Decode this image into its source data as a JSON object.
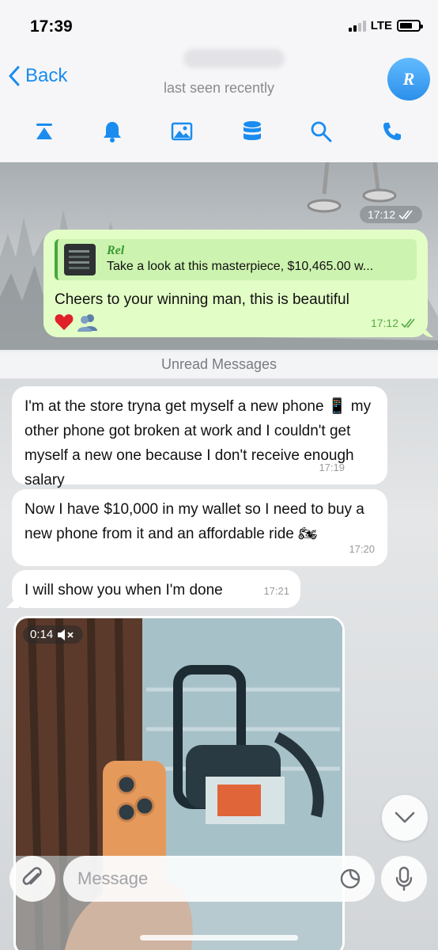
{
  "status_bar": {
    "time": "17:39",
    "network": "LTE",
    "battery_percent": 70
  },
  "header": {
    "back_label": "Back",
    "subtitle": "last seen recently",
    "avatar_initial": "R",
    "avatar_color": "#3b9ef2",
    "accent_color": "#1a8cf0"
  },
  "toolbar": {
    "icons": [
      "pin-top-icon",
      "bell-icon",
      "gallery-icon",
      "database-icon",
      "search-icon",
      "phone-icon"
    ]
  },
  "chat": {
    "previous_image_time": "17:12",
    "outgoing": {
      "reply_name": "Rel",
      "reply_text": "Take a look at this masterpiece, $10,465.00 w...",
      "text": "Cheers to your winning man, this is beautiful",
      "emojis": [
        "red-heart-icon",
        "busts-in-silhouette-icon"
      ],
      "time": "17:12",
      "bubble_color": "#e2fec6"
    },
    "unread_label": "Unread Messages",
    "incoming": [
      {
        "text": "I'm at the store tryna get myself a new phone 📱 my other phone got broken at work and I couldn't get myself a new one because I don't receive enough salary",
        "time": "17:19"
      },
      {
        "text": "Now I have $10,000 in my wallet so I need to buy a new phone from it and an affordable ride 🏍",
        "time": "17:20"
      },
      {
        "text": "I will show you when I'm done",
        "time": "17:21"
      }
    ],
    "video": {
      "duration": "0:14",
      "muted": true
    }
  },
  "composer": {
    "placeholder": "Message"
  }
}
